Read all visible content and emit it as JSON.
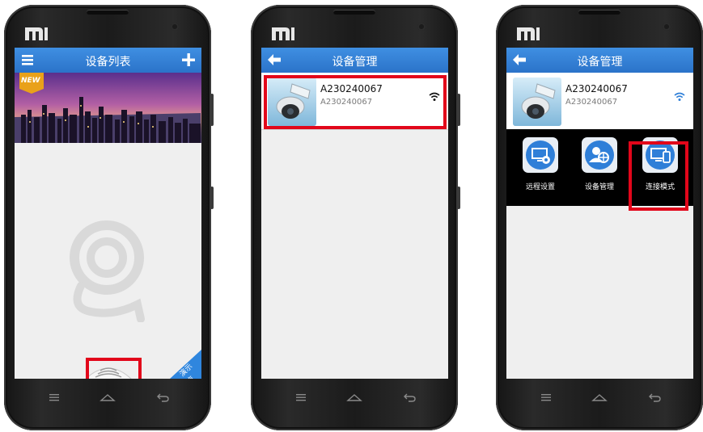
{
  "phone1": {
    "title": "设备列表",
    "icons": {
      "left": "menu-icon",
      "right": "plus-icon"
    },
    "banner_badge": "NEW",
    "demo_ribbon": "演示点"
  },
  "phone2": {
    "title": "设备管理",
    "icons": {
      "left": "back-arrow-icon"
    },
    "device": {
      "name": "A230240067",
      "id": "A230240067",
      "status_icon": "wifi-icon"
    }
  },
  "phone3": {
    "title": "设备管理",
    "icons": {
      "left": "back-arrow-icon"
    },
    "device": {
      "name": "A230240067",
      "id": "A230240067",
      "status_icon": "wifi-icon"
    },
    "actions": [
      {
        "label": "远程设置",
        "icon": "remote-settings-icon"
      },
      {
        "label": "设备管理",
        "icon": "device-management-icon"
      },
      {
        "label": "连接模式",
        "icon": "connection-mode-icon"
      }
    ]
  },
  "colors": {
    "accent": "#2f7fd8",
    "highlight": "#e2061a",
    "frame": "#1b1b1b"
  }
}
